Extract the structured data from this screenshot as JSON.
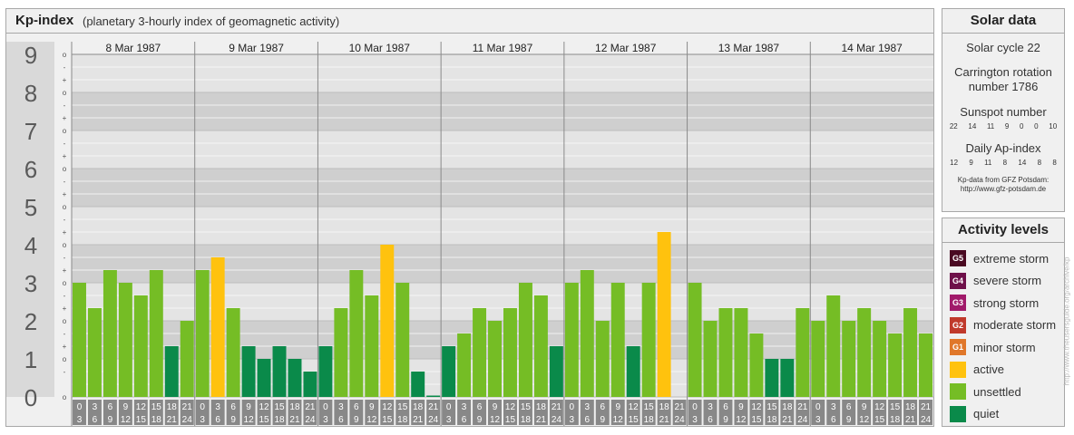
{
  "header": {
    "title": "Kp-index",
    "subtitle": "(planetary 3-hourly index of geomagnetic activity)"
  },
  "chart_data": {
    "type": "bar",
    "title": "Kp-index",
    "subtitle": "(planetary 3-hourly index of geomagnetic activity)",
    "ylim": [
      0,
      9
    ],
    "y_ticks": [
      "0",
      "1",
      "2",
      "3",
      "4",
      "5",
      "6",
      "7",
      "8",
      "9"
    ],
    "minor_tick_labels": [
      "o",
      "+",
      "-"
    ],
    "days": [
      "8 Mar 1987",
      "9 Mar 1987",
      "10 Mar 1987",
      "11 Mar 1987",
      "12 Mar 1987",
      "13 Mar 1987",
      "14 Mar 1987"
    ],
    "interval_starts": [
      "0",
      "3",
      "6",
      "9",
      "12",
      "15",
      "18",
      "21"
    ],
    "interval_ends": [
      "3",
      "6",
      "9",
      "12",
      "15",
      "18",
      "21",
      "24"
    ],
    "values": [
      [
        3.0,
        2.333,
        3.333,
        3.0,
        2.667,
        3.333,
        1.333,
        2.0
      ],
      [
        3.333,
        3.667,
        2.333,
        1.333,
        1.0,
        1.333,
        1.0,
        0.667
      ],
      [
        1.333,
        2.333,
        3.333,
        2.667,
        4.0,
        3.0,
        0.667,
        0.0
      ],
      [
        1.333,
        1.667,
        2.333,
        2.0,
        2.333,
        3.0,
        2.667,
        1.333
      ],
      [
        3.0,
        3.333,
        2.0,
        3.0,
        1.333,
        3.0,
        4.333
      ],
      [
        3.0,
        2.0,
        2.333,
        2.333,
        1.667,
        1.0,
        1.0,
        2.333
      ],
      [
        2.0,
        2.667,
        2.0,
        2.333,
        2.0,
        1.667,
        2.333,
        1.667
      ]
    ],
    "colors": {
      "G5": "#4a0a22",
      "G4": "#6e1049",
      "G3": "#a11a6a",
      "G2": "#c0392b",
      "G1": "#e0772a",
      "active": "#ffc20e",
      "unsettled": "#75bd25",
      "quiet": "#0a8a4a"
    }
  },
  "solar": {
    "title": "Solar data",
    "cycle": "Solar cycle 22",
    "carrington": "Carrington rotation number 1786",
    "sunspot_label": "Sunspot number",
    "sunspot_values": [
      "22",
      "14",
      "11",
      "9",
      "0",
      "0",
      "10"
    ],
    "ap_label": "Daily Ap-index",
    "ap_values": [
      "12",
      "9",
      "11",
      "8",
      "14",
      "8",
      "8"
    ],
    "source_line1": "Kp-data from GFZ Potsdam:",
    "source_line2": "http://www.gfz-potsdam.de"
  },
  "activity": {
    "title": "Activity levels",
    "items": [
      {
        "code": "G5",
        "label": "extreme storm",
        "color": "#4a0a22"
      },
      {
        "code": "G4",
        "label": "severe storm",
        "color": "#6e1049"
      },
      {
        "code": "G3",
        "label": "strong storm",
        "color": "#a11a6a"
      },
      {
        "code": "G2",
        "label": "moderate storm",
        "color": "#c0392b"
      },
      {
        "code": "G1",
        "label": "minor storm",
        "color": "#e0772a"
      },
      {
        "code": "",
        "label": "active",
        "color": "#ffc20e"
      },
      {
        "code": "",
        "label": "unsettled",
        "color": "#75bd25"
      },
      {
        "code": "",
        "label": "quiet",
        "color": "#0a8a4a"
      }
    ]
  },
  "credit": "http://www.theusersguide.org/archive/kp"
}
